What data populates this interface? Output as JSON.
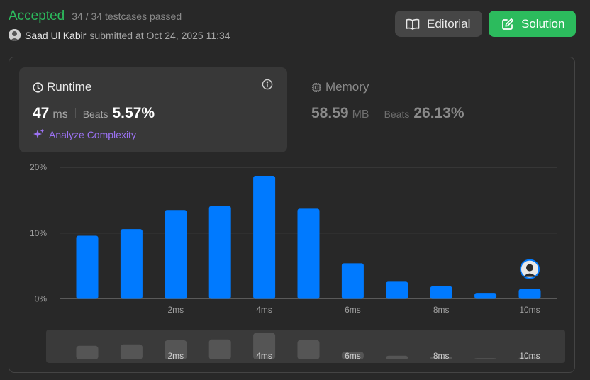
{
  "header": {
    "status": "Accepted",
    "testcases": "34 / 34 testcases passed",
    "user": "Saad Ul Kabir",
    "submitted": "submitted at Oct 24, 2025 11:34"
  },
  "buttons": {
    "editorial": "Editorial",
    "solution": "Solution"
  },
  "runtime": {
    "title": "Runtime",
    "value": "47",
    "unit": "ms",
    "beats_label": "Beats",
    "beats": "5.57%",
    "analyze": "Analyze Complexity"
  },
  "memory": {
    "title": "Memory",
    "value": "58.59",
    "unit": "MB",
    "beats_label": "Beats",
    "beats": "26.13%"
  },
  "colors": {
    "accepted": "#2cbb5d",
    "bar": "#007aff",
    "analyze": "#9b72f2"
  },
  "chart_data": {
    "type": "bar",
    "x_tick_labels": [
      "2ms",
      "4ms",
      "6ms",
      "8ms",
      "10ms"
    ],
    "y_tick_labels": [
      "20%",
      "10%",
      "0%"
    ],
    "ylim": [
      0,
      20
    ],
    "values": [
      9.6,
      10.6,
      13.5,
      14.1,
      18.7,
      13.7,
      5.4,
      2.6,
      1.9,
      0.9,
      1.5
    ],
    "highlight_index": 10,
    "grid": true
  }
}
